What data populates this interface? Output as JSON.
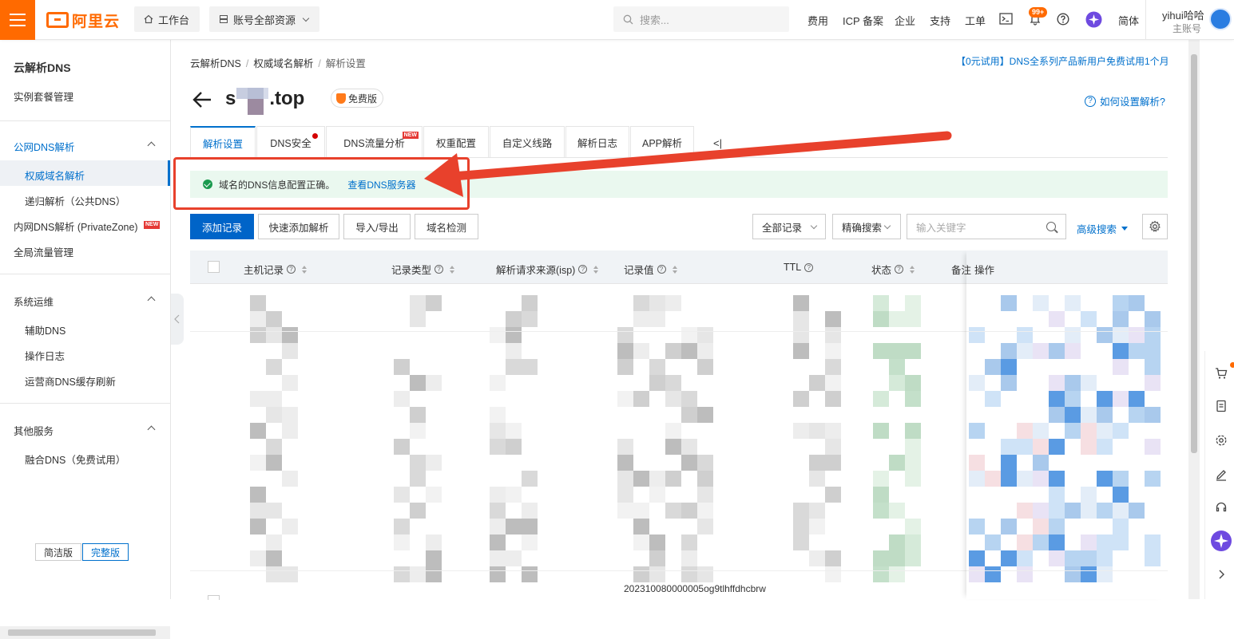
{
  "colors": {
    "brand": "#ff6a00",
    "primary": "#0064c8",
    "link": "#0070cc",
    "annotation": "#e8412c",
    "success_bg": "#eaf8ef"
  },
  "topbar": {
    "logo_text": "阿里云",
    "workbench": "工作台",
    "resources": "账号全部资源",
    "search_placeholder": "搜索...",
    "links": [
      "费用",
      "ICP 备案",
      "企业",
      "支持",
      "工单"
    ],
    "badge": "99+",
    "lang": "简体",
    "user_name": "yihui哈哈",
    "user_role": "主账号"
  },
  "sidebar": {
    "title": "云解析DNS",
    "package": "实例套餐管理",
    "public_dns": "公网DNS解析",
    "authoritative": "权威域名解析",
    "recursive": "递归解析（公共DNS）",
    "private_zone": "内网DNS解析 (PrivateZone)",
    "new_tag": "NEW",
    "global_traffic": "全局流量管理",
    "ops": "系统运维",
    "aux_dns": "辅助DNS",
    "op_log": "操作日志",
    "isp_refresh": "运营商DNS缓存刷新",
    "other": "其他服务",
    "fusion": "融合DNS（免费试用）",
    "simple_mode": "简洁版",
    "full_mode": "完整版"
  },
  "breadcrumb": {
    "l1": "云解析DNS",
    "l2": "权威域名解析",
    "l3": "解析设置"
  },
  "promo": "【0元试用】DNS全系列产品新用户免费试用1个月",
  "domain": {
    "prefix": "s",
    "suffix": ".top",
    "edition": "免费版"
  },
  "help_link": "如何设置解析?",
  "tabs": [
    {
      "label": "解析设置"
    },
    {
      "label": "DNS安全"
    },
    {
      "label": "DNS流量分析"
    },
    {
      "label": "权重配置"
    },
    {
      "label": "自定义线路"
    },
    {
      "label": "解析日志"
    },
    {
      "label": "APP解析"
    }
  ],
  "tab_more": "<|",
  "alert": {
    "text": "域名的DNS信息配置正确。",
    "link": "查看DNS服务器"
  },
  "toolbar": {
    "add": "添加记录",
    "quick_add": "快速添加解析",
    "import_export": "导入/导出",
    "check": "域名检测",
    "filter_all": "全部记录",
    "exact": "精确搜索",
    "keyword_placeholder": "输入关键字",
    "advanced": "高级搜索"
  },
  "table": {
    "columns": {
      "host": "主机记录",
      "type": "记录类型",
      "isp": "解析请求来源(isp)",
      "value": "记录值",
      "ttl": "TTL",
      "status": "状态",
      "remark": "备注",
      "ops": "操作"
    },
    "visible_record_id": "202310080000005og9tlhffdhcbrw"
  }
}
